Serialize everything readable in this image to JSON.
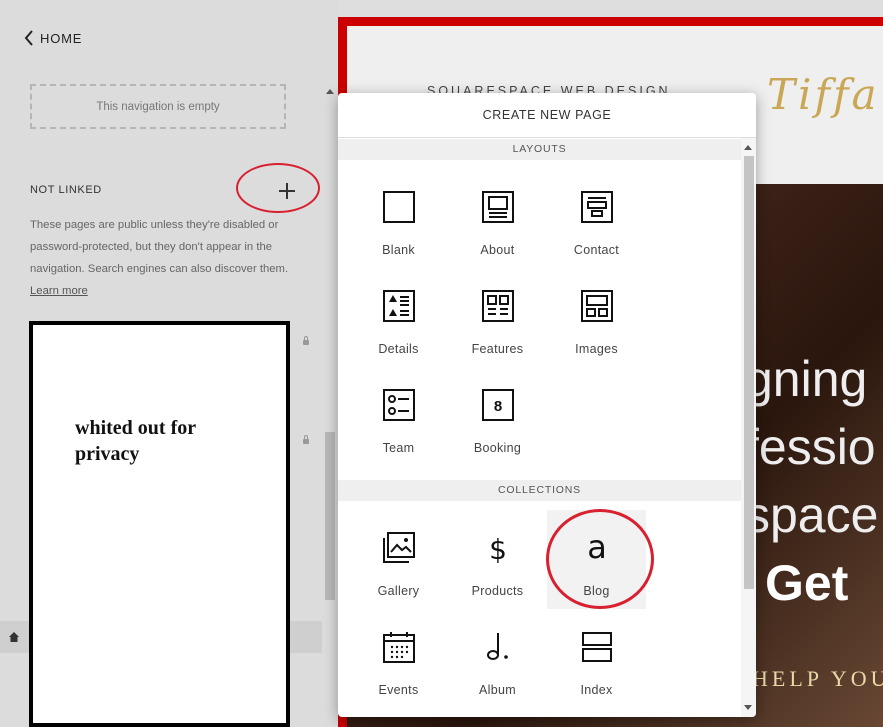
{
  "sidebar": {
    "home_label": "HOME",
    "nav_empty": "This navigation is empty",
    "not_linked_title": "NOT LINKED",
    "info_text": "These pages are public unless they're disabled or password-protected, but they don't appear in the navigation. Search engines can also discover them.",
    "learn_more": "Learn more",
    "whiteout_text": "whited out for privacy"
  },
  "site": {
    "header_text": "SQUARESPACE WEB DESIGN",
    "logo_text": "Tiffa",
    "hero_lines": [
      "gning",
      "fessio",
      "space",
      "Get"
    ],
    "hero_sub": "HELP YOU"
  },
  "modal": {
    "title": "CREATE NEW PAGE",
    "layouts_header": "LAYOUTS",
    "collections_header": "COLLECTIONS",
    "layouts": [
      {
        "label": "Blank",
        "icon": "blank-page-icon"
      },
      {
        "label": "About",
        "icon": "about-layout-icon"
      },
      {
        "label": "Contact",
        "icon": "contact-layout-icon"
      },
      {
        "label": "Details",
        "icon": "details-layout-icon"
      },
      {
        "label": "Features",
        "icon": "features-layout-icon"
      },
      {
        "label": "Images",
        "icon": "images-layout-icon"
      },
      {
        "label": "Team",
        "icon": "team-layout-icon"
      },
      {
        "label": "Booking",
        "icon": "booking-layout-icon"
      }
    ],
    "collections": [
      {
        "label": "Gallery",
        "icon": "gallery-icon"
      },
      {
        "label": "Products",
        "icon": "dollar-icon"
      },
      {
        "label": "Blog",
        "icon": "blog-icon",
        "glyph": "a"
      },
      {
        "label": "Events",
        "icon": "calendar-icon"
      },
      {
        "label": "Album",
        "icon": "music-note-icon"
      },
      {
        "label": "Index",
        "icon": "index-icon"
      }
    ],
    "booking_glyph": "8",
    "products_glyph": "$"
  },
  "colors": {
    "annotation": "#d8202e",
    "frame": "#cc0000",
    "logo": "#c9a757"
  }
}
